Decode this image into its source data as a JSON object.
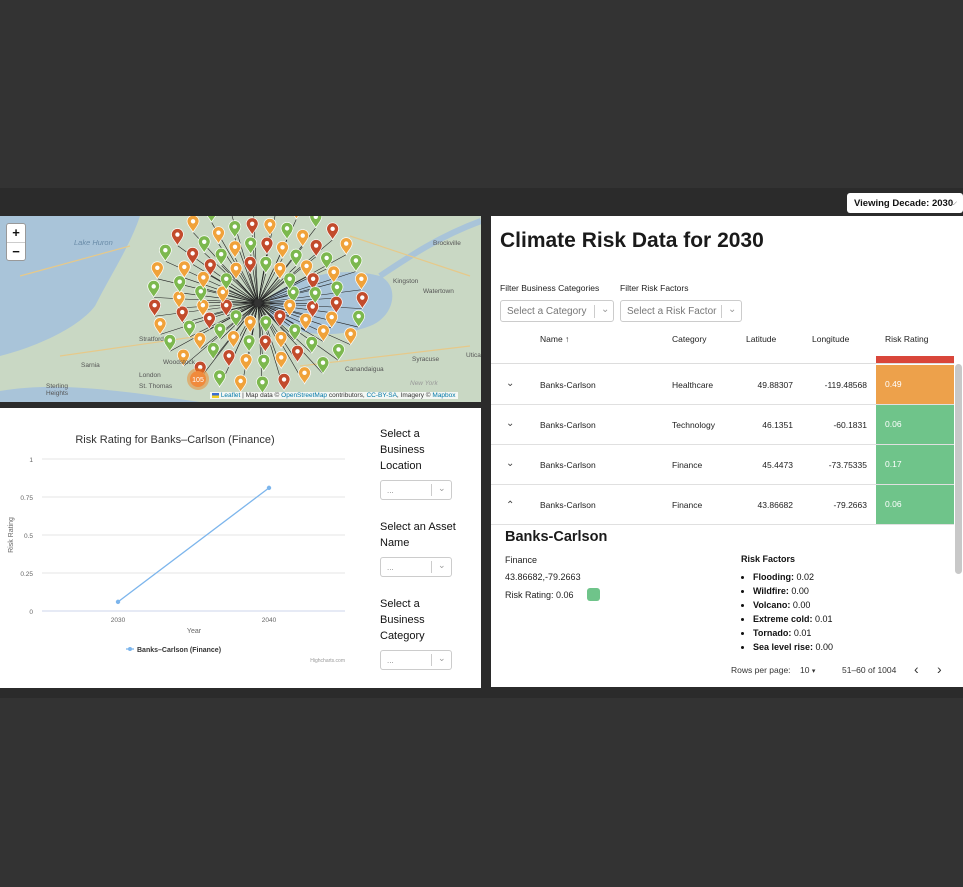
{
  "decade_selector": {
    "label": "Viewing Decade: 2030"
  },
  "map": {
    "zoom_in": "+",
    "zoom_out": "−",
    "labels": {
      "lake_huron": "Lake Huron",
      "brockville": "Brockville",
      "kingston": "Kingston",
      "watertown": "Watertown",
      "syracuse": "Syracuse",
      "utica": "Utica",
      "stratford": "Stratford",
      "sarnia": "Sarnia",
      "london": "London",
      "st_thomas": "St. Thomas",
      "woodstock": "Woodstock",
      "sterling_heights": "Sterling Heights",
      "canandaigua": "Canandaigua",
      "new_york": "New York"
    },
    "cluster_count": "105",
    "attribution": {
      "leaflet": "Leaflet",
      "middle": " | Map data © ",
      "osm": "OpenStreetMap",
      "contributors": " contributors, ",
      "license": "CC-BY-SA",
      "imagery": ", Imagery © ",
      "mapbox": "Mapbox"
    },
    "pin_colors": {
      "green": "#7cb84e",
      "orange": "#f0a23a",
      "red": "#c24b2c"
    }
  },
  "chart_panel": {
    "selectors": [
      {
        "label": "Select a Business Location",
        "value": "..."
      },
      {
        "label": "Select an Asset Name",
        "value": "..."
      },
      {
        "label": "Select a Business Category",
        "value": "..."
      }
    ],
    "credit": "Highcharts.com"
  },
  "chart_data": {
    "type": "line",
    "title": "Risk Rating for Banks–Carlson (Finance)",
    "xlabel": "Year",
    "ylabel": "Risk Rating",
    "x": [
      "2030",
      "2040"
    ],
    "y_ticks": [
      "0",
      "0.25",
      "0.5",
      "0.75",
      "1"
    ],
    "ylim": [
      0,
      1
    ],
    "series": [
      {
        "name": "Banks–Carlson (Finance)",
        "values": [
          0.06,
          0.81
        ],
        "color": "#7cb5ec"
      }
    ],
    "grid": true,
    "legend_position": "bottom"
  },
  "data_panel": {
    "title": "Climate Risk Data for 2030",
    "filters": [
      {
        "label": "Filter Business Categories",
        "placeholder": "Select a Category"
      },
      {
        "label": "Filter Risk Factors",
        "placeholder": "Select a Risk Factor"
      }
    ],
    "columns": [
      "Name ↑",
      "Category",
      "Latitude",
      "Longitude",
      "Risk Rating"
    ],
    "rows": [
      {
        "name": "Banks-Carlson",
        "category": "Healthcare",
        "lat": "49.88307",
        "lon": "-119.48568",
        "risk": "0.49",
        "color": "#eda14b",
        "icon": "⌄"
      },
      {
        "name": "Banks-Carlson",
        "category": "Technology",
        "lat": "46.1351",
        "lon": "-60.1831",
        "risk": "0.06",
        "color": "#6fc48a",
        "icon": "⌄"
      },
      {
        "name": "Banks-Carlson",
        "category": "Finance",
        "lat": "45.4473",
        "lon": "-73.75335",
        "risk": "0.17",
        "color": "#6fc48a",
        "icon": "⌄"
      },
      {
        "name": "Banks-Carlson",
        "category": "Finance",
        "lat": "43.86682",
        "lon": "-79.2663",
        "risk": "0.06",
        "color": "#6fc48a",
        "icon": "⌃"
      }
    ],
    "detail": {
      "title": "Banks-Carlson",
      "category": "Finance",
      "coords": "43.86682,-79.2663",
      "risk_rating": "Risk Rating: 0.06",
      "risk_factors_title": "Risk Factors",
      "risk_factors": [
        {
          "name": "Flooding:",
          "value": " 0.02"
        },
        {
          "name": "Wildfire:",
          "value": " 0.00"
        },
        {
          "name": "Volcano:",
          "value": " 0.00"
        },
        {
          "name": "Extreme cold:",
          "value": " 0.01"
        },
        {
          "name": "Tornado:",
          "value": " 0.01"
        },
        {
          "name": "Sea level rise:",
          "value": " 0.00"
        }
      ]
    },
    "pagination": {
      "rows_per_page_label": "Rows per page:",
      "rows_per_page": "10",
      "range": "51–60 of 1004",
      "prev": "‹",
      "next": "›"
    }
  }
}
